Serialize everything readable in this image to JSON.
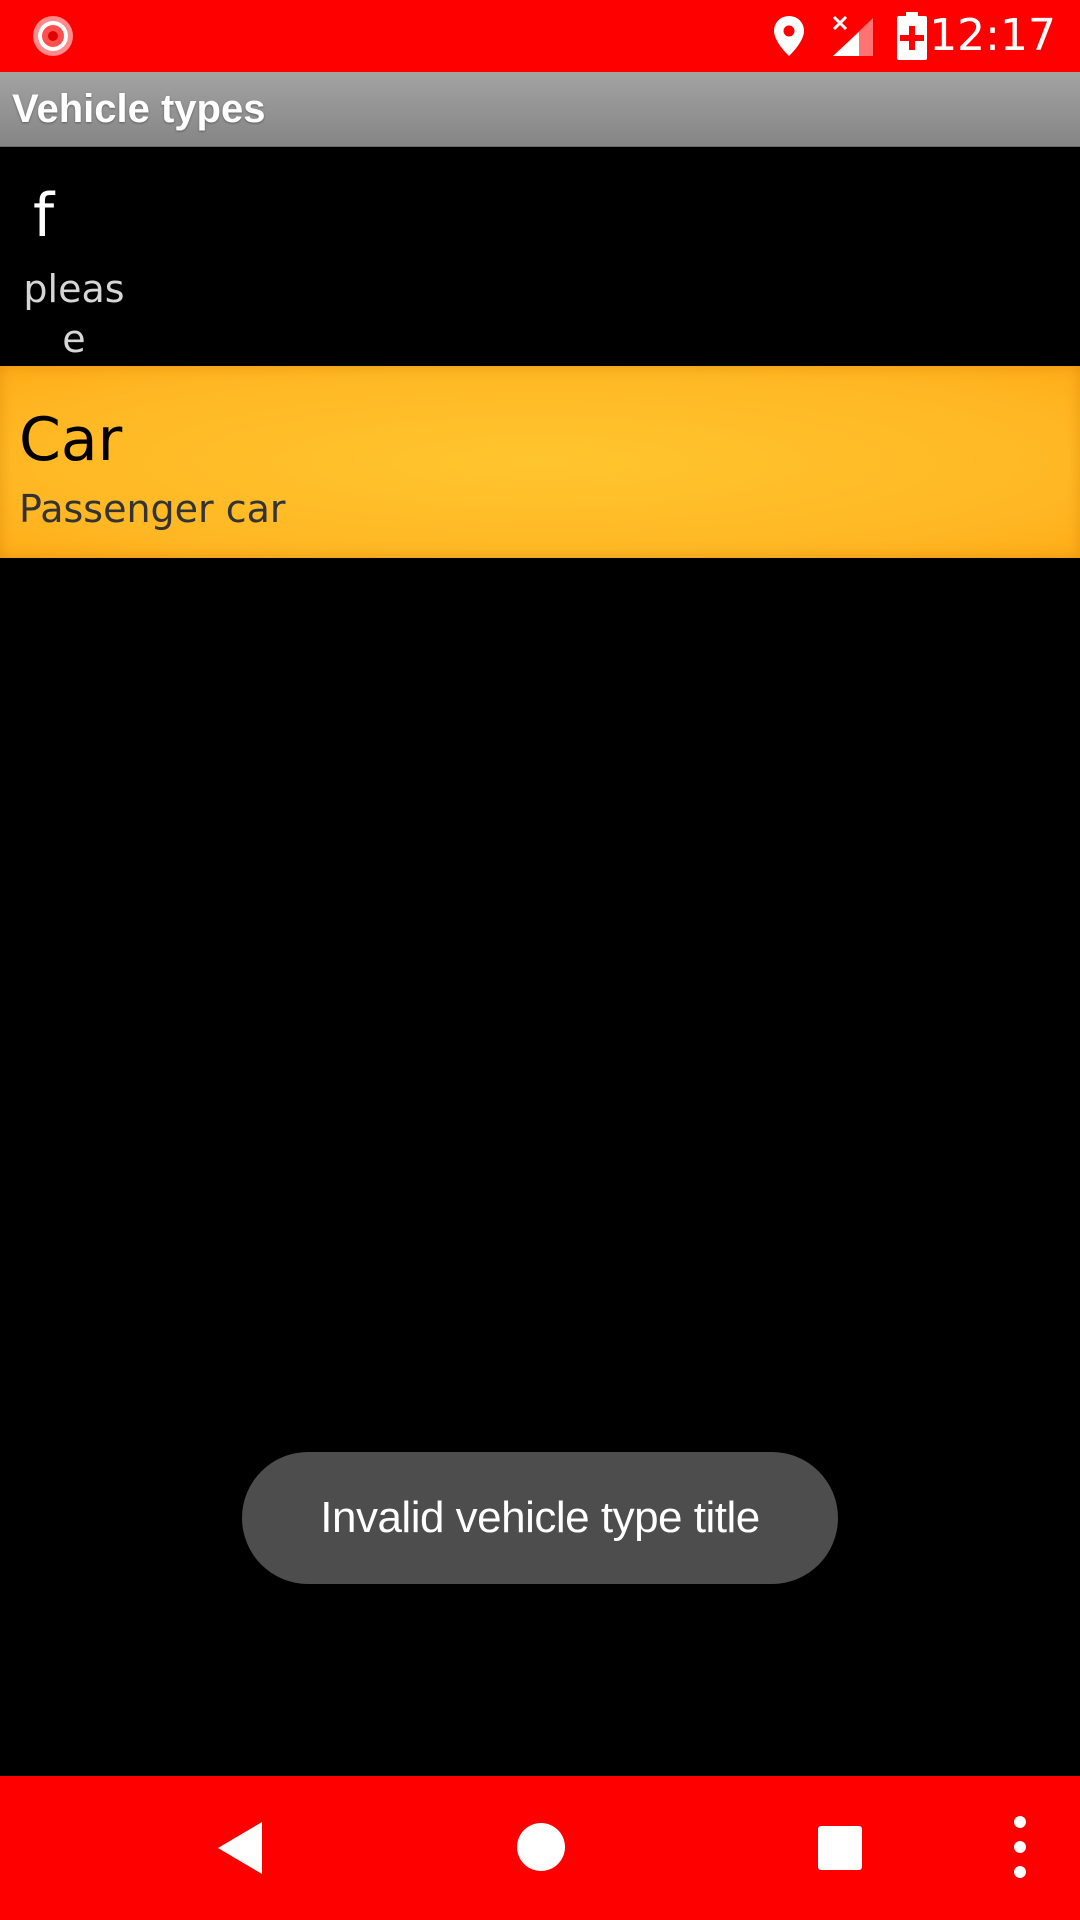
{
  "status_bar": {
    "time": "12:17",
    "icons": [
      "record-icon",
      "location-icon",
      "signal-icon",
      "battery-charging-icon"
    ],
    "background_color": "#ff0000"
  },
  "action_bar": {
    "title": "Vehicle types"
  },
  "vehicle_list": [
    {
      "title": "f",
      "subtitle": "please"
    },
    {
      "title": "Car",
      "subtitle": "Passenger car",
      "highlight_color": "#ffb824"
    }
  ],
  "toast": {
    "message": "Invalid vehicle type title"
  },
  "nav_bar": {
    "icons": [
      "back-icon",
      "home-icon",
      "recents-icon",
      "overflow-menu-icon"
    ],
    "background_color": "#ff0000"
  }
}
